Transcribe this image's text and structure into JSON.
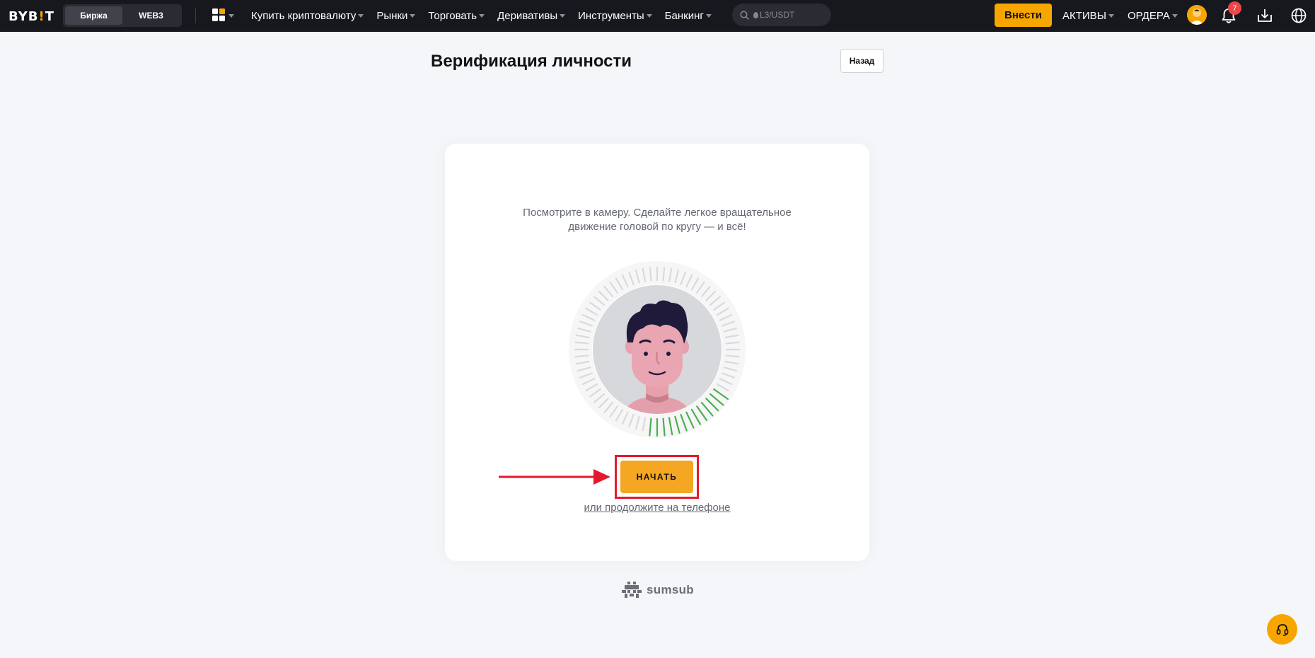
{
  "nav": {
    "logo_main": "BYB",
    "logo_accent": "!",
    "logo_end": "T",
    "segments": [
      "Биржа",
      "WEB3"
    ],
    "menu": [
      "Купить криптовалюту",
      "Рынки",
      "Торговать",
      "Деривативы",
      "Инструменты",
      "Банкинг"
    ],
    "search_placeholder": "L3/USDT",
    "deposit_label": "Внести",
    "assets_label": "АКТИВЫ",
    "orders_label": "ОРДЕРА",
    "notification_count": "7",
    "icons": [
      "apps-grid-icon",
      "search-icon",
      "user-avatar-icon",
      "bell-icon",
      "download-icon",
      "globe-icon"
    ]
  },
  "page": {
    "title": "Верификация личности",
    "back_label": "Назад"
  },
  "card": {
    "instruction_line1": "Посмотрите в камеру. Сделайте легкое вращательное",
    "instruction_line2": "движение головой по кругу — и всё!",
    "start_label": "НАЧАТЬ",
    "phone_link": "или продолжите на телефоне"
  },
  "footer": {
    "brand": "sumsub"
  },
  "colors": {
    "accent": "#f7a600",
    "nav_bg": "#17181e",
    "page_bg": "#f5f6f9",
    "highlight_red": "#e5192c",
    "progress_green": "#4caf50"
  }
}
